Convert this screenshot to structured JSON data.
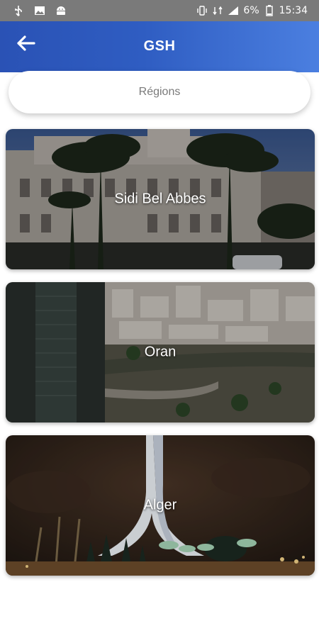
{
  "status_bar": {
    "battery_percent": "6%",
    "time": "15:34",
    "icons": [
      "usb-icon",
      "image-icon",
      "android-icon",
      "vibrate-icon",
      "data-icon",
      "signal-icon",
      "battery-icon"
    ]
  },
  "header": {
    "title": "GSH",
    "back_icon": "arrow-left-icon",
    "gradient": [
      "#2a52b5",
      "#4b7fe0"
    ]
  },
  "search": {
    "label": "Régions"
  },
  "regions": [
    {
      "name": "Sidi Bel Abbes"
    },
    {
      "name": "Oran"
    },
    {
      "name": "Alger"
    }
  ]
}
